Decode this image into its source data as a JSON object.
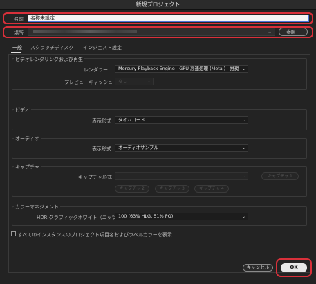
{
  "window": {
    "title": "新規プロジェクト"
  },
  "project": {
    "name_label": "名前",
    "name_value": "名称未設定",
    "location_label": "場所",
    "browse_label": "参照..."
  },
  "tabs": [
    {
      "label": "一般"
    },
    {
      "label": "スクラッチディスク"
    },
    {
      "label": "インジェスト設定"
    }
  ],
  "video_rendering": {
    "title": "ビデオレンダリングおよび再生",
    "renderer_label": "レンダラー",
    "renderer_value": "Mercury Playback Engine - GPU 高速処理 (Metal) - 推奨",
    "preview_cache_label": "プレビューキャッシュ",
    "preview_cache_value": "なし"
  },
  "video": {
    "title": "ビデオ",
    "display_format_label": "表示形式",
    "display_format_value": "タイムコード"
  },
  "audio": {
    "title": "オーディオ",
    "display_format_label": "表示形式",
    "display_format_value": "オーディオサンプル"
  },
  "capture": {
    "title": "キャプチャ",
    "format_label": "キャプチャ形式",
    "format_value": "",
    "buttons": [
      "キャプチャ 1",
      "キャプチャ 2",
      "キャプチャ 3",
      "キャプチャ 4"
    ]
  },
  "color_management": {
    "title": "カラーマネジメント",
    "hdr_label": "HDR グラフィックホワイト（ニッツ）",
    "hdr_value": "100 (63% HLG, 51% PQ)"
  },
  "options": {
    "show_labels_label": "すべてのインスタンスのプロジェクト項目名およびラベルカラーを表示"
  },
  "footer": {
    "cancel_label": "キャンセル",
    "ok_label": "OK"
  },
  "colors": {
    "highlight": "#d9303a",
    "focus_border": "#4a73d8",
    "background": "#232323"
  }
}
